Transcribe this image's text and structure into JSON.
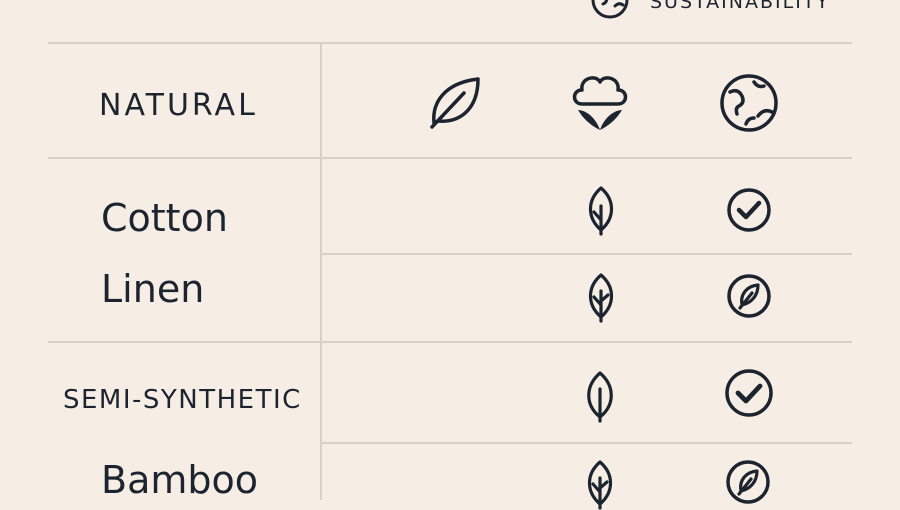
{
  "header": {
    "title": "SUSTAINABILITY",
    "title_icon": "globe-icon"
  },
  "columns": [
    {
      "icon": "leaf-icon"
    },
    {
      "icon": "cotton-flower-icon"
    },
    {
      "icon": "globe-icon"
    }
  ],
  "sections": [
    {
      "label": "NATURAL",
      "rows": [
        {
          "name": "Cotton",
          "icons": [
            "leaf-outline-icon",
            "check-circle-icon"
          ]
        },
        {
          "name": "Linen",
          "icons": [
            "leaf-outline-icon",
            "leaf-circle-icon"
          ]
        }
      ]
    },
    {
      "label": "SEMI-SYNTHETIC",
      "rows": [
        {
          "name": "",
          "icons": [
            "leaf-outline-icon",
            "check-circle-icon"
          ]
        },
        {
          "name": "Bamboo",
          "icons": [
            "leaf-outline-icon",
            "leaf-circle-icon"
          ]
        }
      ]
    }
  ],
  "colors": {
    "background": "#f6eee4",
    "ink": "#1c2430",
    "grid": "#d9d1c6"
  }
}
